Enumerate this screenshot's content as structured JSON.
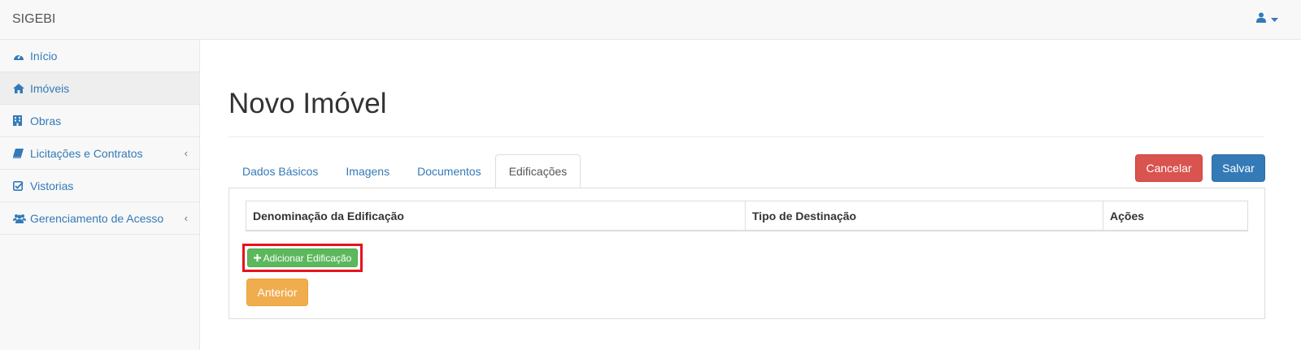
{
  "navbar": {
    "brand": "SIGEBI",
    "user_icon": "user-icon",
    "caret_icon": "caret-down-icon"
  },
  "sidebar": {
    "items": [
      {
        "label": "Início",
        "icon": "dashboard-icon",
        "active": false,
        "has_submenu": false
      },
      {
        "label": "Imóveis",
        "icon": "home-icon",
        "active": true,
        "has_submenu": false
      },
      {
        "label": "Obras",
        "icon": "building-icon",
        "active": false,
        "has_submenu": false
      },
      {
        "label": "Licitações e Contratos",
        "icon": "book-icon",
        "active": false,
        "has_submenu": true
      },
      {
        "label": "Vistorias",
        "icon": "check-square-icon",
        "active": false,
        "has_submenu": false
      },
      {
        "label": "Gerenciamento de Acesso",
        "icon": "users-icon",
        "active": false,
        "has_submenu": true
      }
    ],
    "chevron": "‹"
  },
  "main": {
    "title": "Novo Imóvel",
    "tabs": [
      {
        "label": "Dados Básicos",
        "active": false
      },
      {
        "label": "Imagens",
        "active": false
      },
      {
        "label": "Documentos",
        "active": false
      },
      {
        "label": "Edificações",
        "active": true
      }
    ],
    "buttons": {
      "cancel": "Cancelar",
      "save": "Salvar"
    },
    "table": {
      "columns": [
        "Denominação da Edificação",
        "Tipo de Destinação",
        "Ações"
      ],
      "rows": []
    },
    "add_button": {
      "icon": "plus-icon",
      "label": "Adicionar Edificação"
    },
    "prev_button": "Anterior"
  },
  "colors": {
    "link": "#337ab7",
    "danger": "#d9534f",
    "primary": "#337ab7",
    "success": "#5cb85c",
    "warning": "#f0ad4e",
    "highlight": "#e8121c"
  }
}
